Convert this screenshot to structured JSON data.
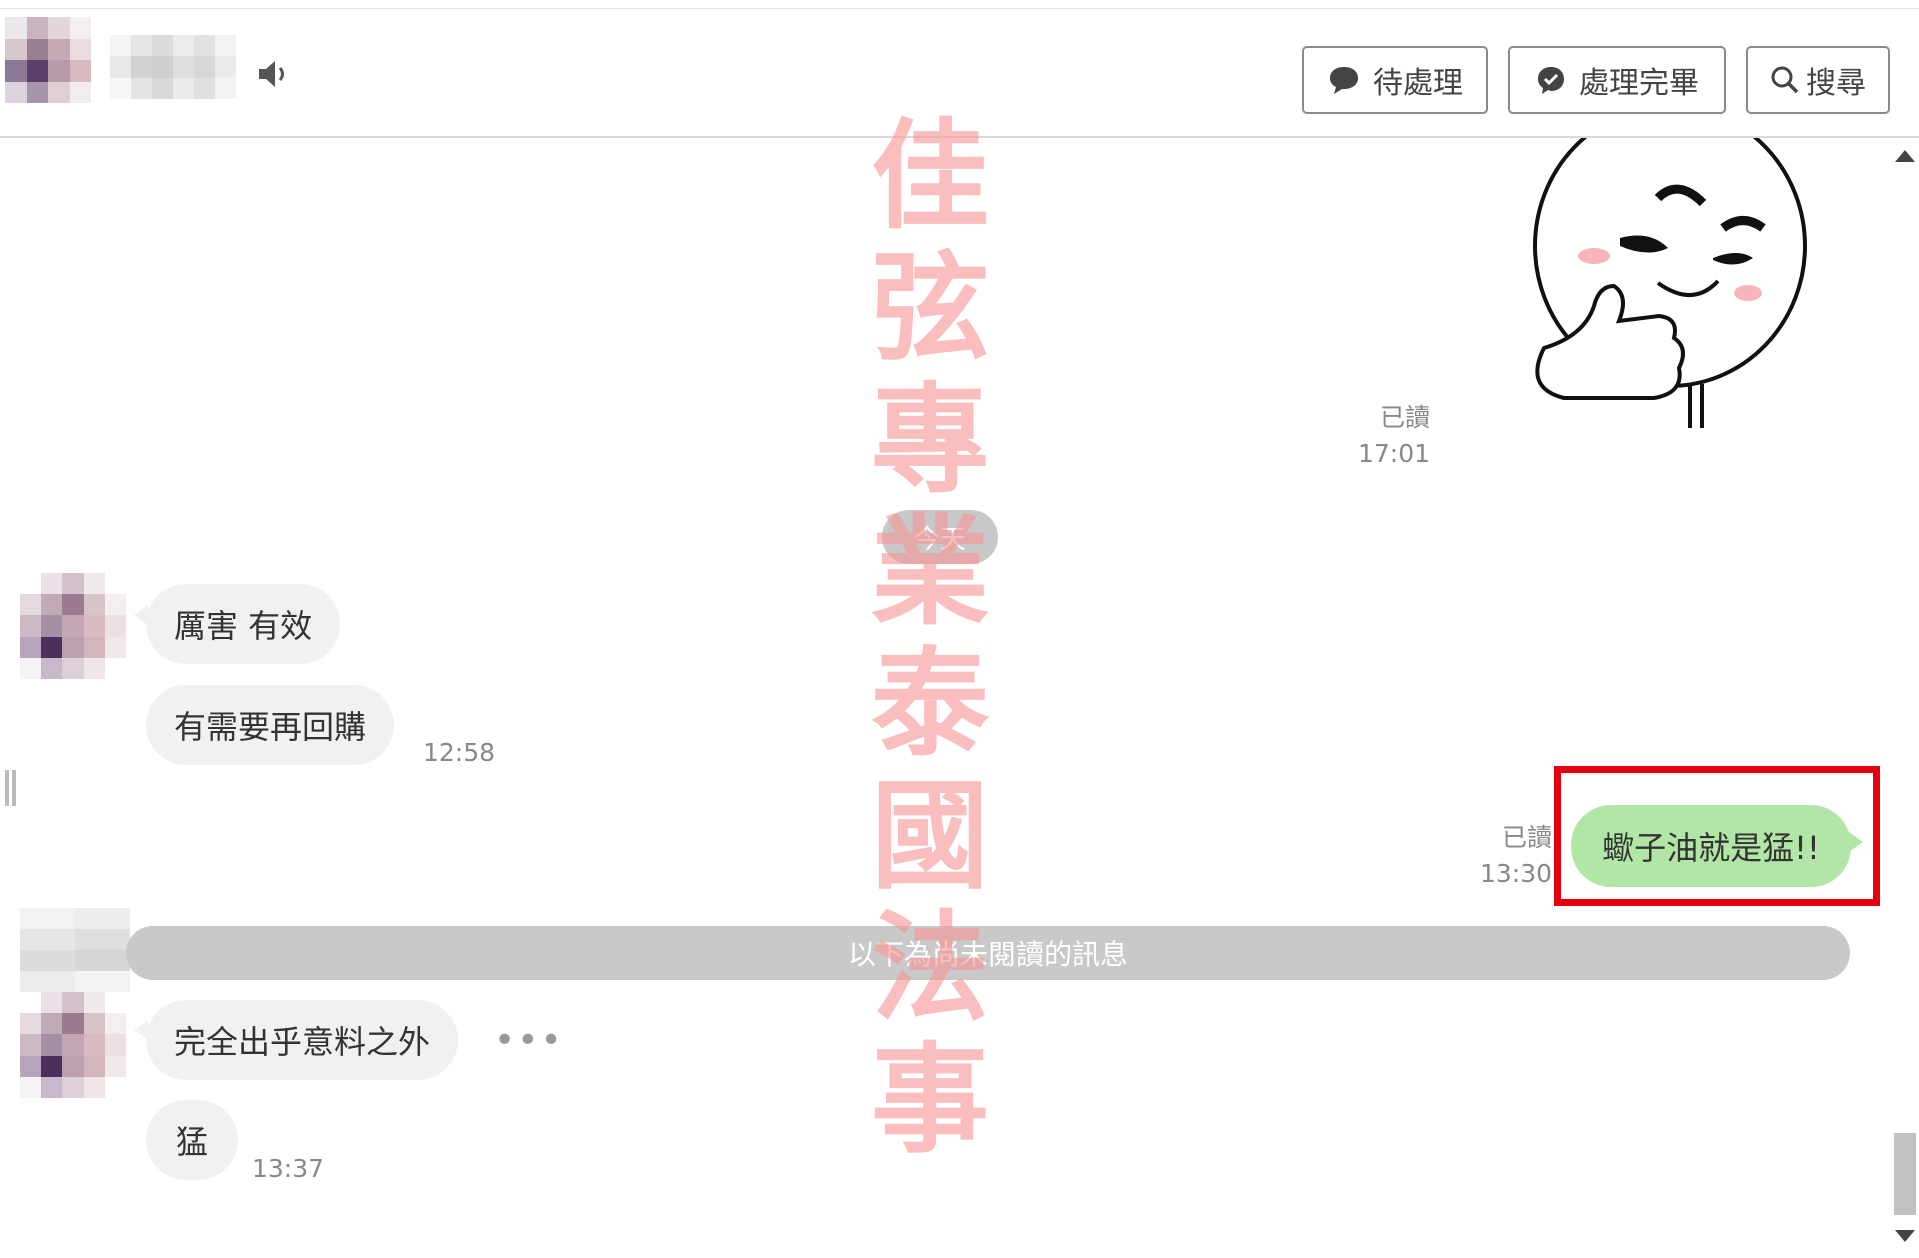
{
  "header": {
    "buttons": [
      {
        "label": "待處理",
        "icon": "speech-bubble-icon"
      },
      {
        "label": "處理完畢",
        "icon": "check-bubble-icon"
      },
      {
        "label": "搜尋",
        "icon": "search-icon"
      }
    ]
  },
  "chat": {
    "sticker_message": {
      "read_label": "已讀",
      "time": "17:01",
      "sticker": "thumbs-up-character-sticker"
    },
    "date_separator": "今天",
    "incoming_1": {
      "lines": [
        "厲害 有效",
        "有需要再回購"
      ],
      "time": "12:58"
    },
    "outgoing_1": {
      "text": "蠍子油就是猛!!",
      "read_label": "已讀",
      "time": "13:30"
    },
    "unread_divider": "以下為尚未閱讀的訊息",
    "incoming_2": {
      "lines": [
        "完全出乎意料之外",
        "猛"
      ],
      "time": "13:37",
      "more": "•••"
    }
  },
  "watermark": {
    "text": [
      "佳",
      "弦",
      "專",
      "業",
      "泰",
      "國",
      "法",
      "事"
    ]
  },
  "colors": {
    "incoming_bubble": "#f1f1f3",
    "outgoing_bubble": "#b1e6a6",
    "highlight": "#e5000f",
    "watermark": "#f79696"
  }
}
